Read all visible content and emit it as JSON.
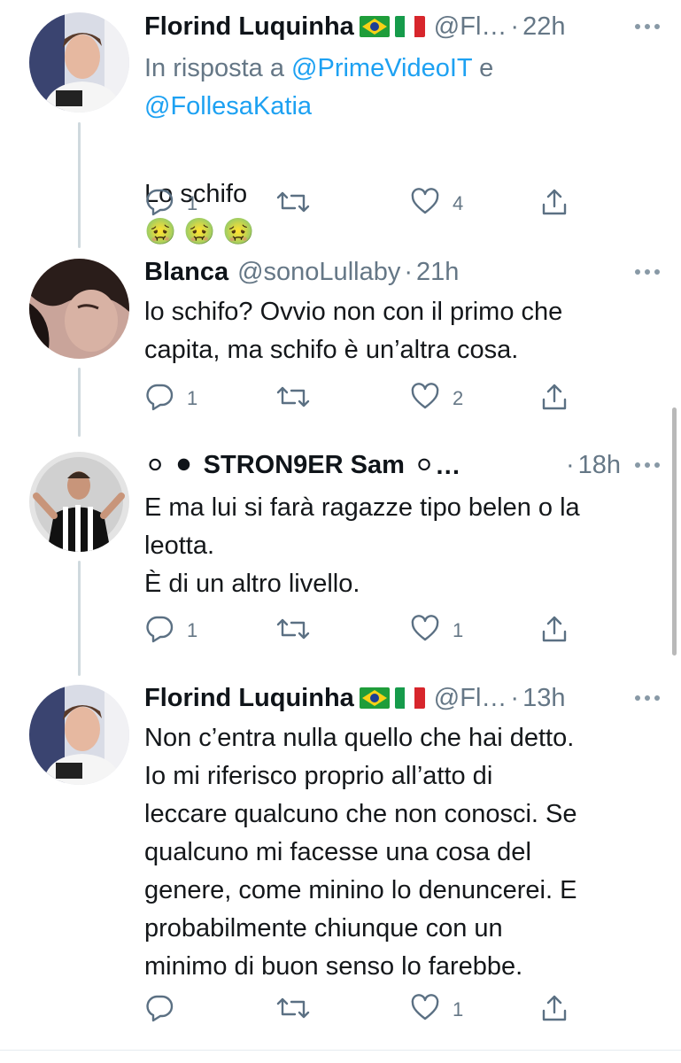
{
  "tweets": [
    {
      "name": "Florind Luquinha",
      "handle": "@Fl…",
      "separator": "·",
      "time": "22h",
      "reply_prefix": "In risposta a ",
      "reply_user1": "@PrimeVideoIT",
      "reply_and": " e",
      "reply_user2": "@FollesaKatia",
      "text": "Lo schifo",
      "emoji": "🤢 🤢 🤢",
      "reply_count": "1",
      "like_count": "4"
    },
    {
      "name": "Blanca",
      "handle": "@sonoLullaby",
      "separator": "·",
      "time": "21h",
      "text": "lo schifo? Ovvio non con il primo che\ncapita, ma schifo è un’altra cosa.",
      "reply_count": "1",
      "like_count": "2"
    },
    {
      "name_prefix": "⚪ ⚫",
      "name": "STRON9ER Sam",
      "name_suffix": "⚪…",
      "separator": "·",
      "time": "18h",
      "text": "E ma lui si farà ragazze tipo belen o la\nleotta.\nÈ di un altro livello.",
      "reply_count": "1",
      "like_count": "1"
    },
    {
      "name": "Florind Luquinha",
      "handle": "@Fl…",
      "separator": "·",
      "time": "13h",
      "text": "Non c’entra nulla quello che hai detto.\nIo mi riferisco proprio all’atto di\nleccare qualcuno che non conosci. Se\nqualcuno mi facesse una cosa del\ngenere, come minino lo denuncerei. E\nprobabilmente chiunque con un\nminimo di buon senso lo farebbe.",
      "reply_count": "",
      "like_count": "1"
    }
  ],
  "icons": {
    "reply": "reply-icon",
    "retweet": "retweet-icon",
    "like": "heart-icon",
    "share": "share-icon",
    "more": "more-icon"
  },
  "colors": {
    "text": "#14171a",
    "secondary": "#657786",
    "link": "#1da1f2",
    "thread_line": "#cfd9de"
  }
}
